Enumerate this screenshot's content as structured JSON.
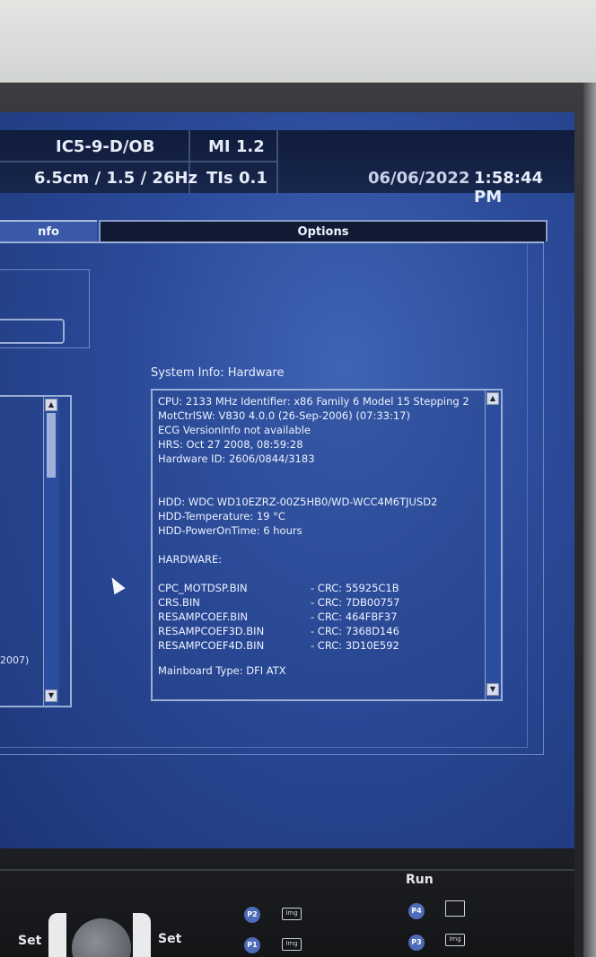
{
  "header": {
    "probe": "IC5-9-D/OB",
    "mi": "MI 1.2",
    "depth": "6.5cm / 1.5 / 26Hz",
    "tis": "TIs 0.1",
    "date": "06/06/2022",
    "time": "1:58:44 PM"
  },
  "tabs": {
    "left": "nfo",
    "right": "Options"
  },
  "system_info": {
    "title": "System Info: Hardware",
    "lines": [
      "CPU: 2133 MHz Identifier: x86 Family 6 Model 15 Stepping 2",
      "MotCtrlSW: V830 4.0.0 (26-Sep-2006) (07:33:17)",
      "ECG VersionInfo not available",
      "HRS: Oct 27 2008, 08:59:28",
      "Hardware ID: 2606/0844/3183"
    ],
    "hdd_lines": [
      "HDD: WDC WD10EZRZ-00Z5HB0/WD-WCC4M6TJUSD2",
      "HDD-Temperature: 19 °C",
      "HDD-PowerOnTime: 6 hours"
    ],
    "hardware_heading": "HARDWARE:",
    "files": [
      {
        "name": "CPC_MOTDSP.BIN",
        "crc": "- CRC: 55925C1B"
      },
      {
        "name": "CRS.BIN",
        "crc": "- CRC: 7DB00757"
      },
      {
        "name": "RESAMPCOEF.BIN",
        "crc": "- CRC: 464FBF37"
      },
      {
        "name": "RESAMPCOEF3D.BIN",
        "crc": "- CRC: 7368D146"
      },
      {
        "name": "RESAMPCOEF4D.BIN",
        "crc": "- CRC: 3D10E592"
      }
    ],
    "mainboard": "Mainboard Type: DFI ATX"
  },
  "left_panel": {
    "fragment": "2007)"
  },
  "console": {
    "run": "Run",
    "set_left": "Set",
    "set_right": "Set",
    "buttons": {
      "p1": "P1",
      "p2": "P2",
      "p3": "P3",
      "p4": "P4"
    },
    "img_label": "Img"
  }
}
